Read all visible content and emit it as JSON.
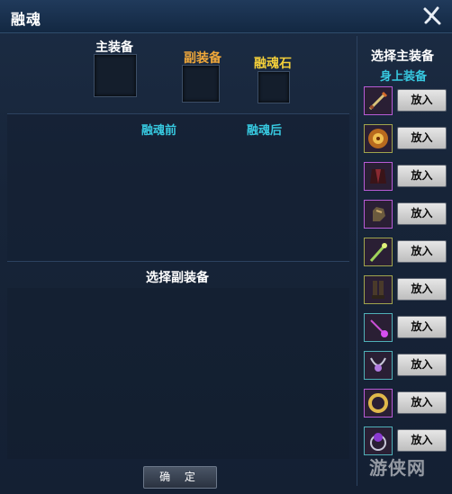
{
  "window": {
    "title": "融魂"
  },
  "slots": {
    "main_label": "主装备",
    "sub_label": "副装备",
    "stone_label": "融魂石"
  },
  "compare": {
    "before": "融魂前",
    "after": "融魂后"
  },
  "sub_select_title": "选择副装备",
  "confirm_label": "确 定",
  "right_panel": {
    "title": "选择主装备",
    "subtitle": "身上装备",
    "items": [
      {
        "icon": "sword-icon",
        "button": "放入"
      },
      {
        "icon": "shield-icon",
        "button": "放入"
      },
      {
        "icon": "armor-icon",
        "button": "放入"
      },
      {
        "icon": "gauntlet-icon",
        "button": "放入"
      },
      {
        "icon": "staff-icon",
        "button": "放入"
      },
      {
        "icon": "boots-icon",
        "button": "放入"
      },
      {
        "icon": "wand-icon",
        "button": "放入"
      },
      {
        "icon": "necklace-icon",
        "button": "放入"
      },
      {
        "icon": "ring-icon",
        "button": "放入"
      },
      {
        "icon": "gem-ring-icon",
        "button": "放入"
      }
    ]
  },
  "watermark": "游侠网"
}
